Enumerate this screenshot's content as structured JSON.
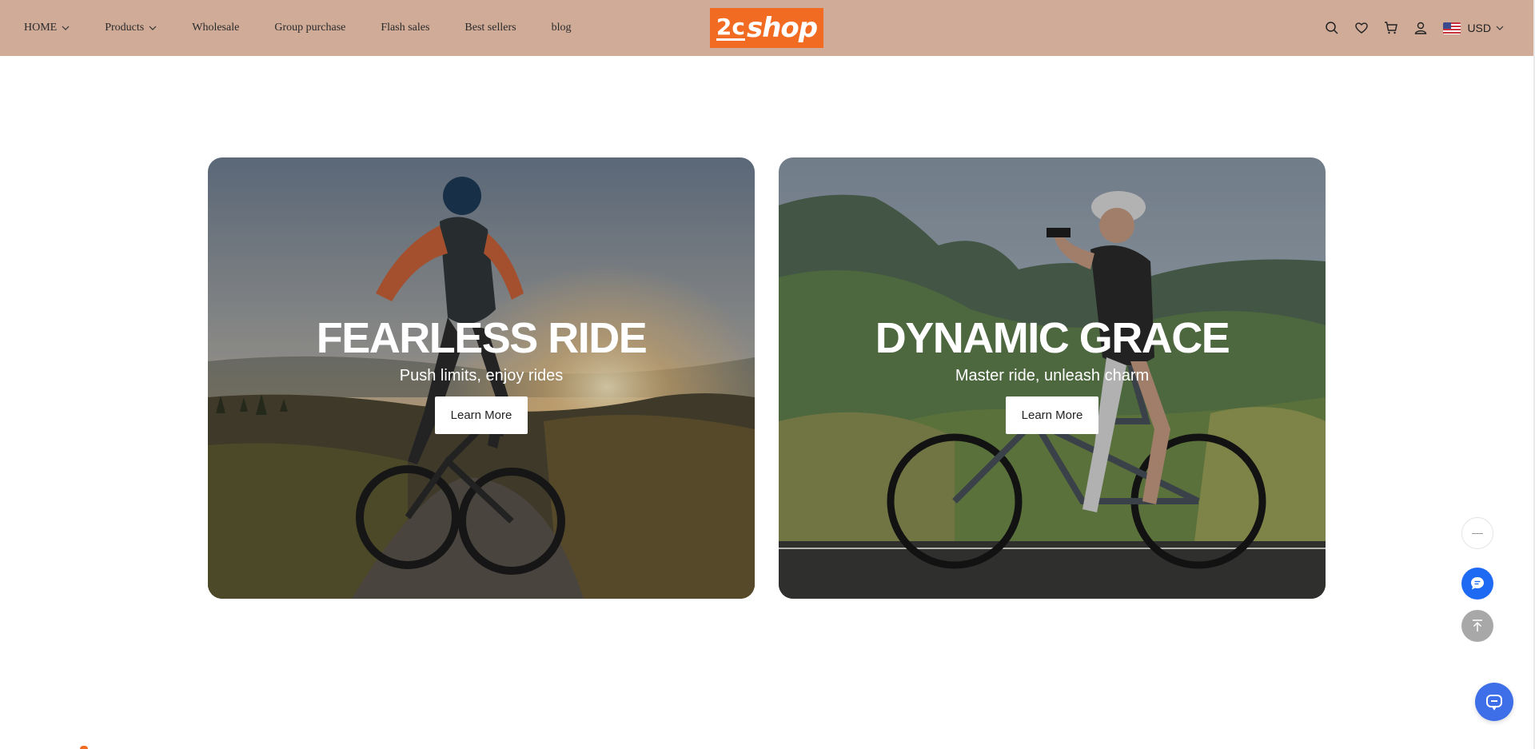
{
  "nav": {
    "items": [
      {
        "label": "HOME",
        "dropdown": true
      },
      {
        "label": "Products",
        "dropdown": true
      },
      {
        "label": "Wholesale",
        "dropdown": false
      },
      {
        "label": "Group purchase",
        "dropdown": false
      },
      {
        "label": "Flash sales",
        "dropdown": false
      },
      {
        "label": "Best sellers",
        "dropdown": false
      },
      {
        "label": "blog",
        "dropdown": false
      }
    ]
  },
  "logo": {
    "mark": "2c",
    "text": "shop",
    "color": "#f26b22"
  },
  "header": {
    "background": "#cfab98",
    "icons": [
      "search-icon",
      "heart-icon",
      "cart-icon",
      "user-icon"
    ],
    "currency": "USD"
  },
  "banners": [
    {
      "title": "FEARLESS RIDE",
      "subtitle": "Push limits, enjoy rides",
      "button": "Learn More"
    },
    {
      "title": "DYNAMIC GRACE",
      "subtitle": "Master ride, unleash charm",
      "button": "Learn More"
    }
  ],
  "floating": {
    "chat_color": "#1e6af2",
    "message_color": "#3e6ee8"
  }
}
